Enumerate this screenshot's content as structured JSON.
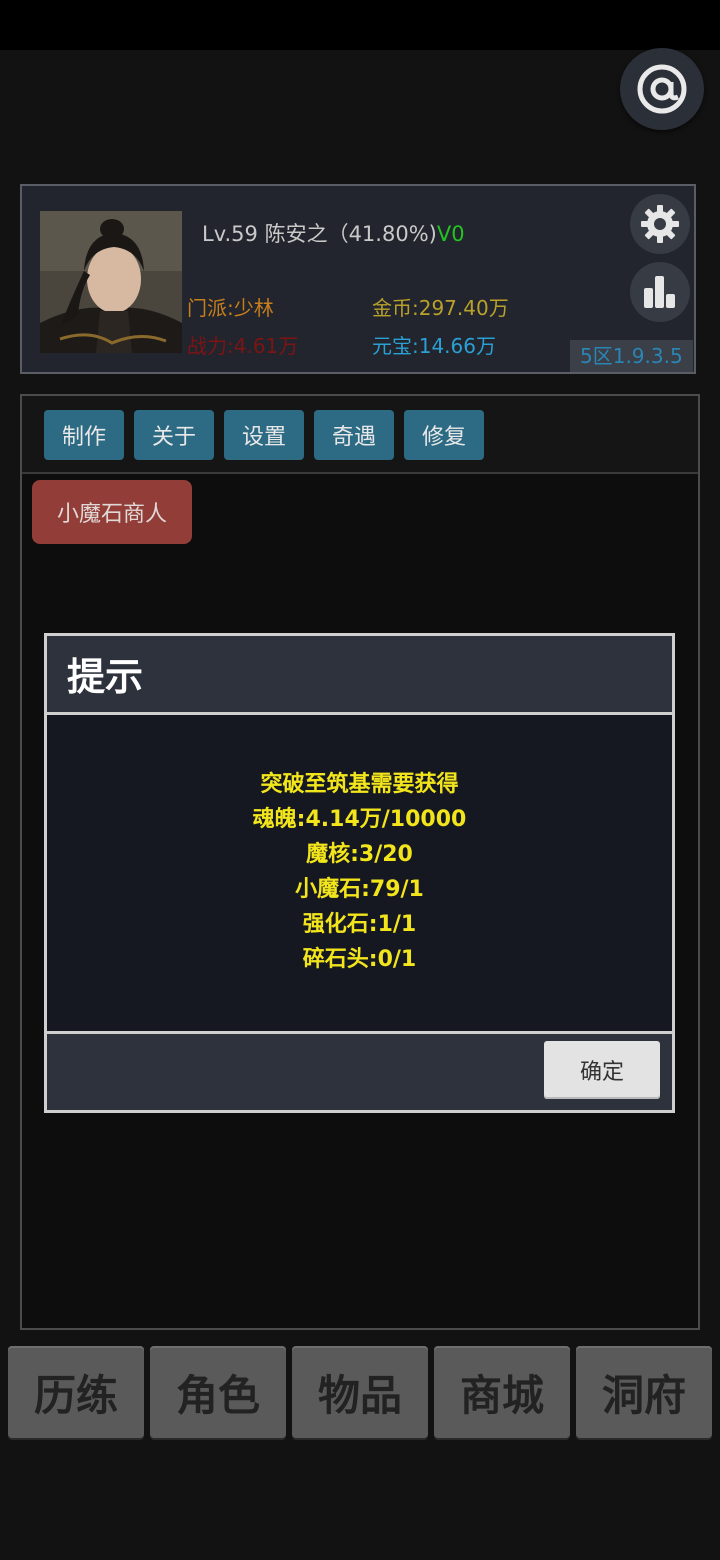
{
  "profile": {
    "level_text": "Lv.59 陈安之（41.80%)",
    "vip": "V0",
    "sect": "门派:少林",
    "power": "战力:4.61万",
    "gold": "金币:297.40万",
    "ingot": "元宝:14.66万",
    "server": "5区1.9.3.5"
  },
  "tabs": [
    "制作",
    "关于",
    "设置",
    "奇遇",
    "修复"
  ],
  "merchant_button": "小魔石商人",
  "dialog": {
    "title": "提示",
    "lines": [
      "突破至筑基需要获得",
      "魂魄:4.14万/10000",
      "魔核:3/20",
      "小魔石:79/1",
      "强化石:1/1",
      "碎石头:0/1"
    ],
    "confirm": "确定"
  },
  "bottom_nav": [
    "历练",
    "角色",
    "物品",
    "商城",
    "洞府"
  ],
  "icons": {
    "at": "at-icon",
    "settings": "gear-icon",
    "ranking": "bar-chart-icon"
  },
  "colors": {
    "tab_bg": "#2d6b84",
    "merchant_bg": "#923d37",
    "dialog_text": "#f2e51c",
    "vip": "#22c322"
  }
}
